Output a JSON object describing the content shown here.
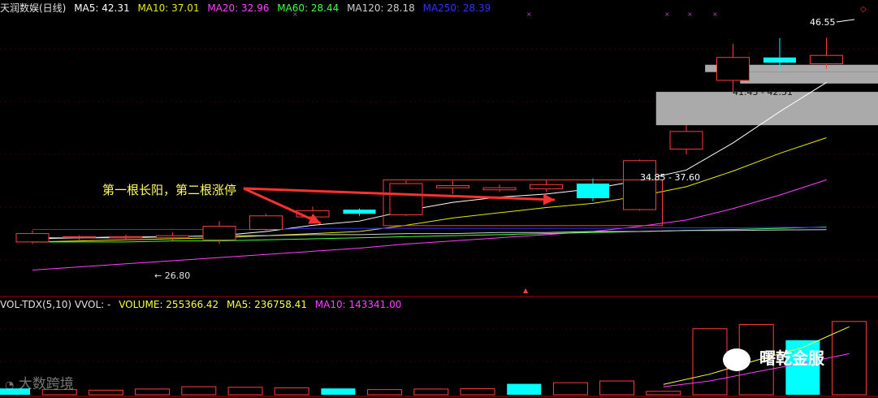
{
  "price_header": {
    "title": "天润数娱(日线)",
    "items": [
      {
        "label": "MA5: 42.31",
        "color": "#ffffff"
      },
      {
        "label": "MA10: 37.01",
        "color": "#e8e800"
      },
      {
        "label": "MA20: 32.96",
        "color": "#ff40ff"
      },
      {
        "label": "MA60: 28.44",
        "color": "#40ff40"
      },
      {
        "label": "MA120: 28.18",
        "color": "#cfcfcf"
      },
      {
        "label": "MA250: 28.39",
        "color": "#3030ff"
      }
    ]
  },
  "volume_header": {
    "title": "VOL-TDX(5,10)  VVOL: -",
    "items": [
      {
        "label": "VOLUME: 255366.42",
        "color": "#ffff40"
      },
      {
        "label": "MA5: 236758.41",
        "color": "#ffff40"
      },
      {
        "label": "MA10: 143341.00",
        "color": "#ff40ff"
      }
    ]
  },
  "annotations": {
    "high_label": "46.55",
    "low_label": "26.80",
    "gap_label_1": "41.43 - 42.51",
    "gap_label_2": "34.85 - 37.60",
    "note": "第一根长阳，第二根涨停",
    "marker": "×",
    "up_marker": "▲"
  },
  "watermarks": {
    "left": "大数跨境",
    "right": "曙乾金服"
  },
  "colors": {
    "up": "#ff3c3c",
    "down": "#00ffff",
    "axis": "#b00000",
    "gap_band": "#aaaaaa",
    "arrow": "#ff3030",
    "note_text": "#ffff60"
  },
  "chart_data": [
    {
      "type": "candlestick",
      "title": "天润数娱(日线)",
      "ylim": [
        22,
        48.5
      ],
      "high_mark": 46.55,
      "low_mark": 26.8,
      "candles": [
        {
          "o": 27.0,
          "c": 27.8,
          "h": 28.1,
          "l": 26.8
        },
        {
          "o": 27.5,
          "c": 27.5,
          "h": 27.6,
          "l": 27.2
        },
        {
          "o": 27.4,
          "c": 27.5,
          "h": 27.7,
          "l": 27.2
        },
        {
          "o": 27.4,
          "c": 27.6,
          "h": 27.9,
          "l": 27.1
        },
        {
          "o": 27.2,
          "c": 28.5,
          "h": 29.0,
          "l": 26.8
        },
        {
          "o": 28.2,
          "c": 29.5,
          "h": 29.7,
          "l": 28.0
        },
        {
          "o": 29.4,
          "c": 30.0,
          "h": 30.4,
          "l": 29.2
        },
        {
          "o": 30.1,
          "c": 29.7,
          "h": 30.2,
          "l": 29.5
        },
        {
          "o": 29.6,
          "c": 32.6,
          "h": 32.9,
          "l": 29.5
        },
        {
          "o": 32.2,
          "c": 32.4,
          "h": 32.9,
          "l": 31.6
        },
        {
          "o": 32.0,
          "c": 32.2,
          "h": 32.5,
          "l": 31.8
        },
        {
          "o": 32.1,
          "c": 32.5,
          "h": 33.0,
          "l": 31.8
        },
        {
          "o": 32.6,
          "c": 31.2,
          "h": 33.1,
          "l": 30.9
        },
        {
          "o": 30.1,
          "c": 34.8,
          "h": 34.9,
          "l": 30.0
        },
        {
          "o": 35.9,
          "c": 37.6,
          "h": 38.2,
          "l": 35.4
        },
        {
          "o": 42.5,
          "c": 44.7,
          "h": 46.0,
          "l": 41.4
        },
        {
          "o": 44.7,
          "c": 44.2,
          "h": 46.55,
          "l": 43.3
        },
        {
          "o": 44.1,
          "c": 44.9,
          "h": 46.6,
          "l": 43.6
        }
      ],
      "ma": [
        {
          "name": "MA5",
          "color": "#ffffff",
          "values": [
            27.3,
            27.4,
            27.4,
            27.5,
            27.6,
            28.0,
            28.6,
            29.0,
            30.0,
            30.8,
            31.3,
            31.6,
            32.1,
            32.9,
            33.9,
            36.5,
            39.5,
            42.3
          ]
        },
        {
          "name": "MA10",
          "color": "#e8e800",
          "values": [
            27.0,
            27.1,
            27.2,
            27.3,
            27.4,
            27.6,
            27.8,
            28.0,
            28.6,
            29.3,
            29.8,
            30.3,
            30.7,
            31.4,
            32.3,
            33.8,
            35.5,
            37.0
          ]
        },
        {
          "name": "MA20",
          "color": "#ff40ff",
          "values": [
            24.3,
            24.6,
            24.9,
            25.2,
            25.5,
            25.8,
            26.1,
            26.4,
            26.8,
            27.1,
            27.4,
            27.7,
            28.0,
            28.5,
            29.1,
            30.2,
            31.5,
            32.96
          ]
        },
        {
          "name": "MA60",
          "color": "#40ff40",
          "values": [
            27.0,
            27.0,
            27.0,
            27.1,
            27.1,
            27.2,
            27.3,
            27.4,
            27.5,
            27.6,
            27.7,
            27.8,
            27.9,
            28.0,
            28.1,
            28.2,
            28.3,
            28.44
          ]
        },
        {
          "name": "MA120",
          "color": "#cfcfcf",
          "values": [
            27.4,
            27.4,
            27.5,
            27.5,
            27.6,
            27.6,
            27.7,
            27.7,
            27.8,
            27.8,
            27.9,
            27.9,
            28.0,
            28.0,
            28.1,
            28.1,
            28.15,
            28.18
          ]
        },
        {
          "name": "MA250",
          "color": "#3030ff",
          "values": [
            28.2,
            28.2,
            28.2,
            28.2,
            28.2,
            28.2,
            28.3,
            28.3,
            28.3,
            28.3,
            28.3,
            28.3,
            28.3,
            28.35,
            28.35,
            28.35,
            28.4,
            28.39
          ]
        }
      ],
      "gaps": [
        {
          "low": 38.2,
          "high": 41.4
        },
        {
          "low": 42.2,
          "high": 43.3
        },
        {
          "low": 43.3,
          "high": 44.0
        }
      ]
    },
    {
      "type": "bar",
      "title": "VOL-TDX(5,10)",
      "ylim": [
        0,
        300000
      ],
      "volumes": [
        {
          "v": 22000,
          "up": false
        },
        {
          "v": 18000,
          "up": true
        },
        {
          "v": 16000,
          "up": true
        },
        {
          "v": 20000,
          "up": true
        },
        {
          "v": 28000,
          "up": true
        },
        {
          "v": 26000,
          "up": true
        },
        {
          "v": 24000,
          "up": true
        },
        {
          "v": 22000,
          "up": false
        },
        {
          "v": 18000,
          "up": true
        },
        {
          "v": 20000,
          "up": true
        },
        {
          "v": 21000,
          "up": true
        },
        {
          "v": 38000,
          "up": false
        },
        {
          "v": 42000,
          "up": true
        },
        {
          "v": 48000,
          "up": true
        },
        {
          "v": 12000,
          "up": true
        },
        {
          "v": 230000,
          "up": true
        },
        {
          "v": 245000,
          "up": true
        },
        {
          "v": 190000,
          "up": false
        },
        {
          "v": 255366.42,
          "up": true
        }
      ],
      "ma": [
        {
          "name": "MA5",
          "color": "#ffff40",
          "values": [
            null,
            null,
            null,
            null,
            null,
            null,
            null,
            null,
            null,
            null,
            null,
            null,
            null,
            null,
            36000,
            72000,
            120000,
            165000,
            236758.41
          ]
        },
        {
          "name": "MA10",
          "color": "#ff40ff",
          "values": [
            null,
            null,
            null,
            null,
            null,
            null,
            null,
            null,
            null,
            null,
            null,
            null,
            null,
            null,
            28000,
            48000,
            80000,
            110000,
            143341.0
          ]
        }
      ]
    }
  ]
}
